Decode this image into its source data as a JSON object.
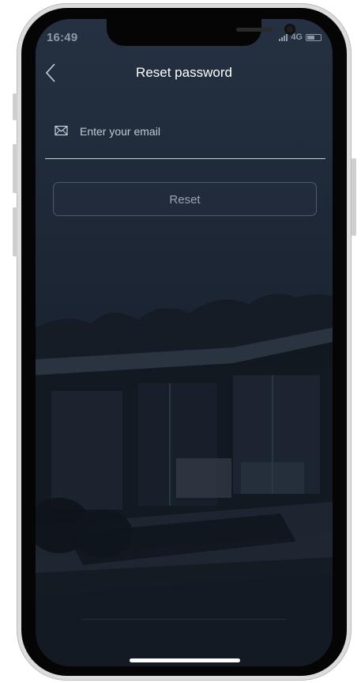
{
  "status_bar": {
    "time": "16:49",
    "network": "4G"
  },
  "header": {
    "back_icon": "chevron-left-icon",
    "title": "Reset password"
  },
  "form": {
    "email_icon": "envelope-icon",
    "email_placeholder": "Enter your email",
    "email_value": "",
    "reset_label": "Reset"
  },
  "colors": {
    "background_top": "#253142",
    "background_bottom": "#161c27",
    "title_text": "#ffffff",
    "button_border": "#4e5a6b",
    "button_text": "#9aa4b1"
  }
}
